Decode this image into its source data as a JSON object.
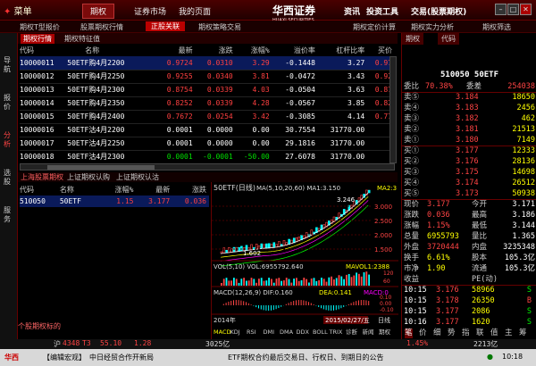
{
  "topbar": {
    "app_menu": "菜单",
    "menus": [
      "期权",
      "证券市场",
      "我的页面"
    ],
    "brand": "华西证券",
    "brand_en": "HUAXI SECURITIES",
    "right_menus": [
      "资讯",
      "投资工具",
      "交易(股票期权)"
    ]
  },
  "subbar": {
    "items": [
      "期权T型报价",
      "股票期权行情",
      "正股关联",
      "期权策略交易"
    ],
    "right_items": [
      "期权定价计算",
      "期权实力分析",
      "期权筛选"
    ]
  },
  "left_strip": [
    "导航",
    "报价",
    "分析",
    "选股",
    "服务"
  ],
  "tabbar": {
    "sel": "期权行情",
    "other": "期权特征值"
  },
  "option_table": {
    "headers": [
      "代码",
      "名称",
      "最新",
      "涨跌",
      "涨幅%",
      "溢价率",
      "杠杆比率",
      "买价"
    ],
    "rows": [
      {
        "code": "10000011",
        "name": "50ETF购4月2200",
        "last": "0.9724",
        "chg": "0.0310",
        "pct": "3.29",
        "prem": "-0.1448",
        "lev": "3.27",
        "bid": "0.97"
      },
      {
        "code": "10000012",
        "name": "50ETF购4月2250",
        "last": "0.9255",
        "chg": "0.0340",
        "pct": "3.81",
        "prem": "-0.0472",
        "lev": "3.43",
        "bid": "0.92"
      },
      {
        "code": "10000013",
        "name": "50ETF购4月2300",
        "last": "0.8754",
        "chg": "0.0339",
        "pct": "4.03",
        "prem": "-0.0504",
        "lev": "3.63",
        "bid": "0.87"
      },
      {
        "code": "10000014",
        "name": "50ETF购4月2350",
        "last": "0.8252",
        "chg": "0.0339",
        "pct": "4.28",
        "prem": "-0.0567",
        "lev": "3.85",
        "bid": "0.82"
      },
      {
        "code": "10000015",
        "name": "50ETF购4月2400",
        "last": "0.7672",
        "pct": "3.42",
        "chg": "0.0254",
        "prem": "-0.3085",
        "lev": "4.14",
        "bid": "0.77"
      },
      {
        "code": "10000016",
        "name": "50ETF沽4月2200",
        "last": "0.0001",
        "chg": "0.0000",
        "pct": "0.00",
        "prem": "30.7554",
        "lev": "31770.00",
        "bid": ""
      },
      {
        "code": "10000017",
        "name": "50ETF沽4月2250",
        "last": "0.0001",
        "chg": "0.0000",
        "pct": "0.00",
        "prem": "29.1816",
        "lev": "31770.00",
        "bid": ""
      },
      {
        "code": "10000018",
        "name": "50ETF沽4月2300",
        "last": "0.0001",
        "chg": "-0.0001",
        "pct": "-50.00",
        "prem": "27.6078",
        "lev": "31770.00",
        "bid": ""
      }
    ]
  },
  "lower_tabs": [
    "上海股票期权",
    "上证期权认购",
    "上证期权认沽"
  ],
  "underlying_table": {
    "headers": [
      "代码",
      "名称",
      "涨幅%",
      "最新",
      "涨跌"
    ],
    "rows": [
      {
        "code": "510050",
        "name": "50ETF",
        "pct": "1.15",
        "last": "3.177",
        "chg": "0.036"
      }
    ]
  },
  "underlying_footer": "个股期权标的",
  "chart": {
    "title": "50ETF(日线)",
    "ma": "MA(5,10,20,60) MA1:3.150",
    "ma2": "MA2:3",
    "peak": "3.246",
    "low": "1.602",
    "y_ticks": [
      "3.000",
      "2.500",
      "2.000",
      "1.500"
    ],
    "vol_label": "VOL(5,10) VOL:6955792.640",
    "vol_ma": "MAVOL1:2388",
    "vol_ticks": [
      "120",
      "60"
    ],
    "macd_label": "MACD(12,26,9) DIF:0.160",
    "macd_dea": "DEA:0.141",
    "macd_val": "MACD:0",
    "macd_ticks": [
      "0.10",
      "0.00",
      "-0.10"
    ],
    "date_left": "2014年",
    "date_right": "2015/02/27/五",
    "period": "日线",
    "tool_items": [
      "MACD",
      "KDJ",
      "RSI",
      "DMI",
      "DMA",
      "DDX",
      "BOLL",
      "TRIX",
      "诊断",
      "新闻",
      "期权"
    ]
  },
  "right_panel": {
    "tabs": [
      "期权",
      "代码"
    ],
    "header": "510050 50ETF",
    "ratio": {
      "label1": "委比",
      "v1": "70.38%",
      "label2": "委差",
      "v2": "254038"
    },
    "asks": [
      {
        "label": "卖⑤",
        "price": "3.184",
        "vol": "18650"
      },
      {
        "label": "卖④",
        "price": "3.183",
        "vol": "2456"
      },
      {
        "label": "卖③",
        "price": "3.182",
        "vol": "462"
      },
      {
        "label": "卖②",
        "price": "3.181",
        "vol": "21513"
      },
      {
        "label": "卖①",
        "price": "3.180",
        "vol": "7149"
      }
    ],
    "bids": [
      {
        "label": "买①",
        "price": "3.177",
        "vol": "12333"
      },
      {
        "label": "买②",
        "price": "3.176",
        "vol": "28136"
      },
      {
        "label": "买③",
        "price": "3.175",
        "vol": "14698"
      },
      {
        "label": "买④",
        "price": "3.174",
        "vol": "26512"
      },
      {
        "label": "买⑤",
        "price": "3.173",
        "vol": "50938"
      }
    ],
    "stats": [
      {
        "l1": "现价",
        "v1": "3.177",
        "l2": "今开",
        "v2": "3.171"
      },
      {
        "l1": "涨跌",
        "v1": "0.036",
        "l2": "最高",
        "v2": "3.186"
      },
      {
        "l1": "涨幅",
        "v1": "1.15%",
        "l2": "最低",
        "v2": "3.144"
      },
      {
        "l1": "总量",
        "v1": "6955793",
        "l2": "量比",
        "v2": "1.365"
      },
      {
        "l1": "外盘",
        "v1": "3720444",
        "l2": "内盘",
        "v2": "3235348"
      },
      {
        "l1": "换手",
        "v1": "6.61%",
        "l2": "股本",
        "v2": "105.3亿"
      },
      {
        "l1": "市净",
        "v1": "1.90",
        "l2": "流通",
        "v2": "105.3亿"
      },
      {
        "l1": "收益",
        "v1": "",
        "l2": "PE(动)",
        "v2": ""
      }
    ],
    "ticks": [
      {
        "time": "10:15",
        "price": "3.176",
        "vol": "58966",
        "side": "S"
      },
      {
        "time": "10:15",
        "price": "3.178",
        "vol": "26350",
        "side": "B"
      },
      {
        "time": "10:15",
        "price": "3.177",
        "vol": "2086",
        "side": "S"
      },
      {
        "time": "10:16",
        "price": "3.177",
        "vol": "1620",
        "side": "S"
      }
    ],
    "bottom_tabs": [
      "笔",
      "价",
      "细",
      "势",
      "指",
      "联",
      "值",
      "主",
      "筹"
    ]
  },
  "bottom_status": {
    "sh": "沪",
    "sh_val": "4348",
    "sh_chg": "T3",
    "sh2": "55.10",
    "sh3": "1.28",
    "amt": "3025亿",
    "c2": "1.45%",
    "amt2": "2213亿"
  },
  "bottom_bar": {
    "brand": "华西",
    "news_label": "【编辑宏观】",
    "news1": "中日经贸合作开新局",
    "news2": "ETF期权合约最后交易日、行权日、到期日的公告",
    "clock": "10:18"
  }
}
